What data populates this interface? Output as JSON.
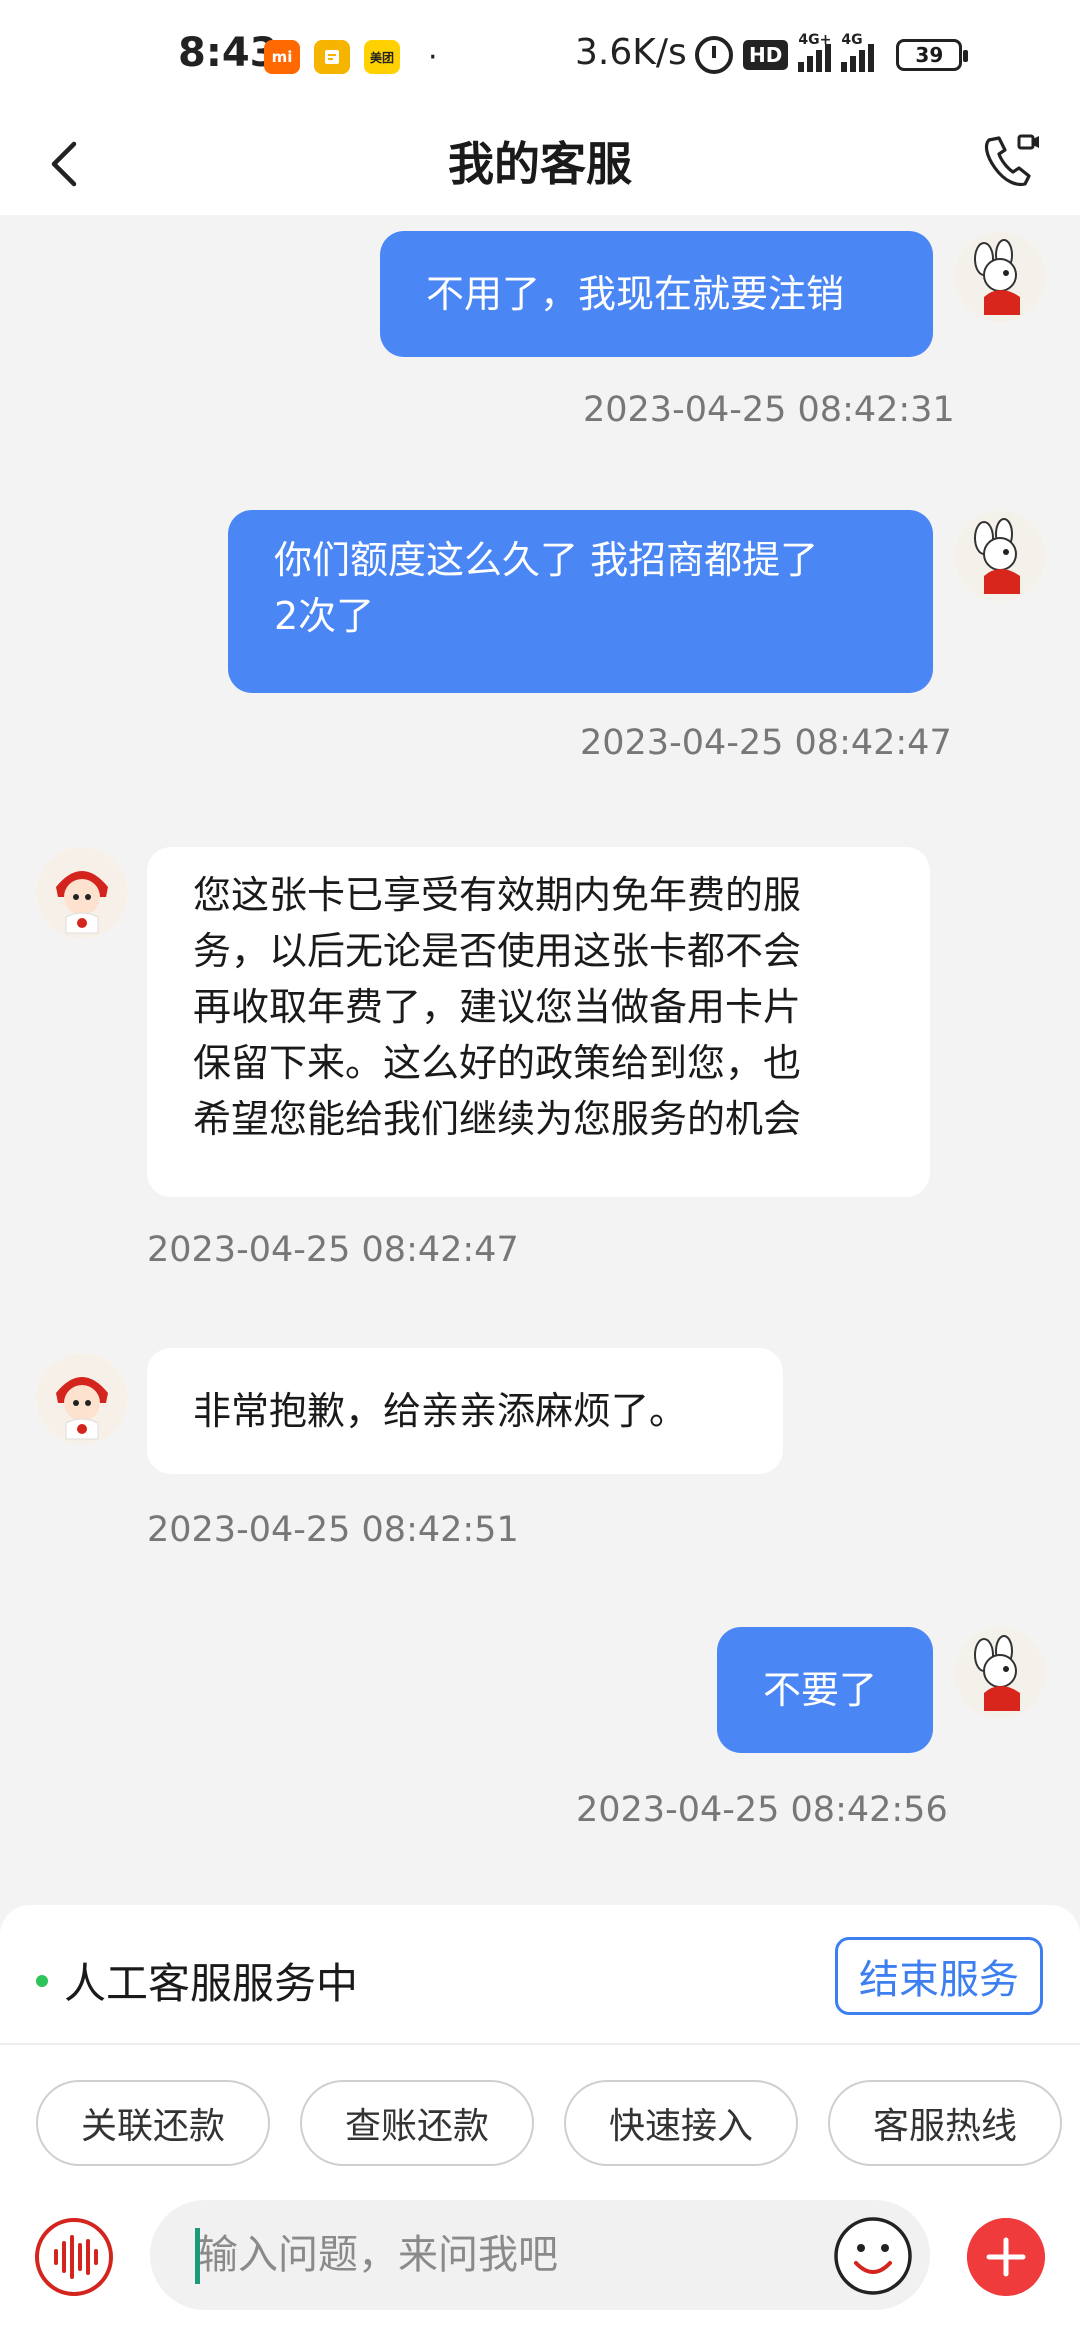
{
  "status_bar": {
    "time": "8:43",
    "app_icons": [
      "mi",
      "notes",
      "meituan"
    ],
    "mi_label": "mi",
    "meituan_label": "美团",
    "dot": "·",
    "net_speed": "3.6K/s",
    "hd_label": "HD",
    "signal1_label": "4G+",
    "signal2_label": "4G",
    "battery": "39"
  },
  "header": {
    "title": "我的客服",
    "back_icon": "chevron-left-icon",
    "call_icon": "phone-video-icon"
  },
  "colors": {
    "user_bubble": "#4b86f5",
    "agent_bubble": "#ffffff",
    "accent_blue": "#3d7ef0",
    "status_green": "#2ec35a",
    "plus_red": "#ef3b3b"
  },
  "messages": [
    {
      "from": "user",
      "text": "不用了，我现在就要注销",
      "time": "2023-04-25 08:42:31"
    },
    {
      "from": "user",
      "text": "你们额度这么久了 我招商都提了2次了",
      "line1": "你们额度这么久了 我招商都提了",
      "line2": "2次了",
      "time": "2023-04-25 08:42:47"
    },
    {
      "from": "agent",
      "lines": [
        "您这张卡已享受有效期内免年费的服",
        "务，以后无论是否使用这张卡都不会",
        "再收取年费了，建议您当做备用卡片",
        "保留下来。这么好的政策给到您，也",
        "希望您能给我们继续为您服务的机会"
      ],
      "time": "2023-04-25 08:42:47"
    },
    {
      "from": "agent",
      "text": "非常抱歉，给亲亲添麻烦了。",
      "time": "2023-04-25 08:42:51"
    },
    {
      "from": "user",
      "text": "不要了",
      "time": "2023-04-25 08:42:56"
    }
  ],
  "panel": {
    "status_text": "人工客服服务中",
    "end_button": "结束服务",
    "quick_actions": [
      "关联还款",
      "查账还款",
      "快速接入",
      "客服热线"
    ],
    "input_placeholder": "输入问题，来问我吧",
    "icons": [
      "voice-icon",
      "emoji-icon",
      "plus-icon"
    ]
  }
}
